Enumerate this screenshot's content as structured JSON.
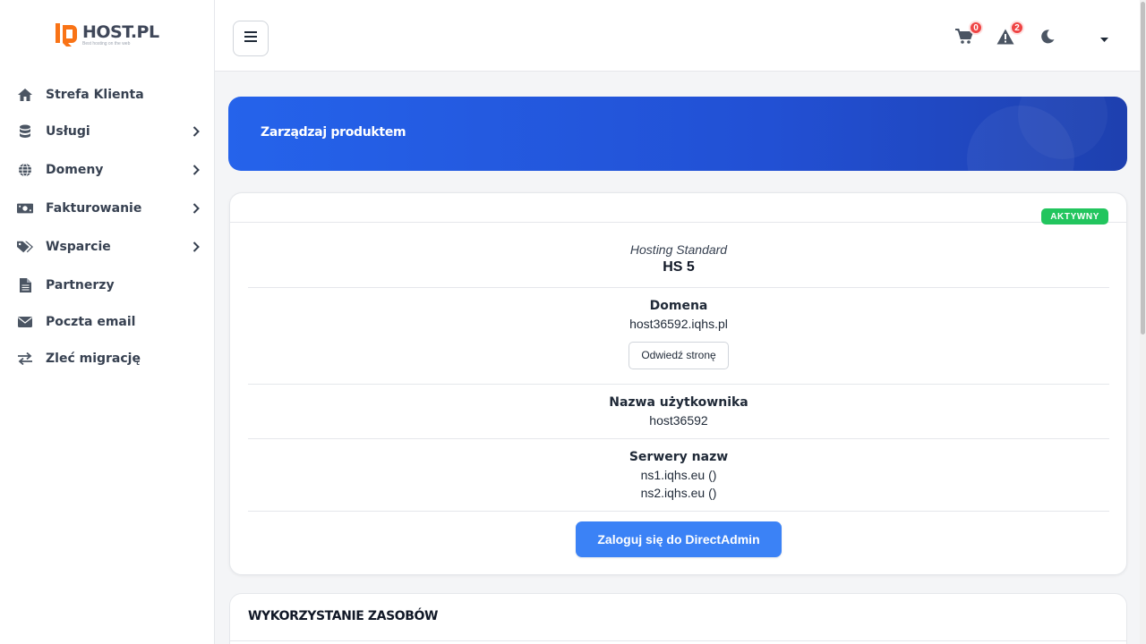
{
  "brand": {
    "name": "HOST.PL",
    "tagline": "Best hosting on the web",
    "accent": "#f97316"
  },
  "sidebar": {
    "items": [
      {
        "label": "Strefa Klienta",
        "icon": "home-icon",
        "has_submenu": false
      },
      {
        "label": "Usługi",
        "icon": "database-icon",
        "has_submenu": true
      },
      {
        "label": "Domeny",
        "icon": "globe-icon",
        "has_submenu": true
      },
      {
        "label": "Fakturowanie",
        "icon": "money-bill-icon",
        "has_submenu": true
      },
      {
        "label": "Wsparcie",
        "icon": "tags-icon",
        "has_submenu": true
      },
      {
        "label": "Partnerzy",
        "icon": "document-icon",
        "has_submenu": false
      },
      {
        "label": "Poczta email",
        "icon": "envelope-icon",
        "has_submenu": false
      },
      {
        "label": "Zleć migrację",
        "icon": "exchange-arrows-icon",
        "has_submenu": false
      }
    ]
  },
  "topbar": {
    "cart_count": "0",
    "alerts_count": "2"
  },
  "banner": {
    "title": "Zarządzaj produktem"
  },
  "product": {
    "status": "AKTYWNY",
    "plan_type": "Hosting Standard",
    "plan_name": "HS 5",
    "domain_label": "Domena",
    "domain_value": "host36592.iqhs.pl",
    "visit_button": "Odwiedź stronę",
    "username_label": "Nazwa użytkownika",
    "username_value": "host36592",
    "nameservers_label": "Serwery nazw",
    "ns1": "ns1.iqhs.eu ()",
    "ns2": "ns2.iqhs.eu ()",
    "login_button": "Zaloguj się do DirectAdmin"
  },
  "resources": {
    "title": "WYKORZYSTANIE ZASOBÓW"
  },
  "colors": {
    "primary": "#2563eb",
    "success": "#22c55e",
    "danger": "#ef4444",
    "button": "#3b82f6"
  }
}
